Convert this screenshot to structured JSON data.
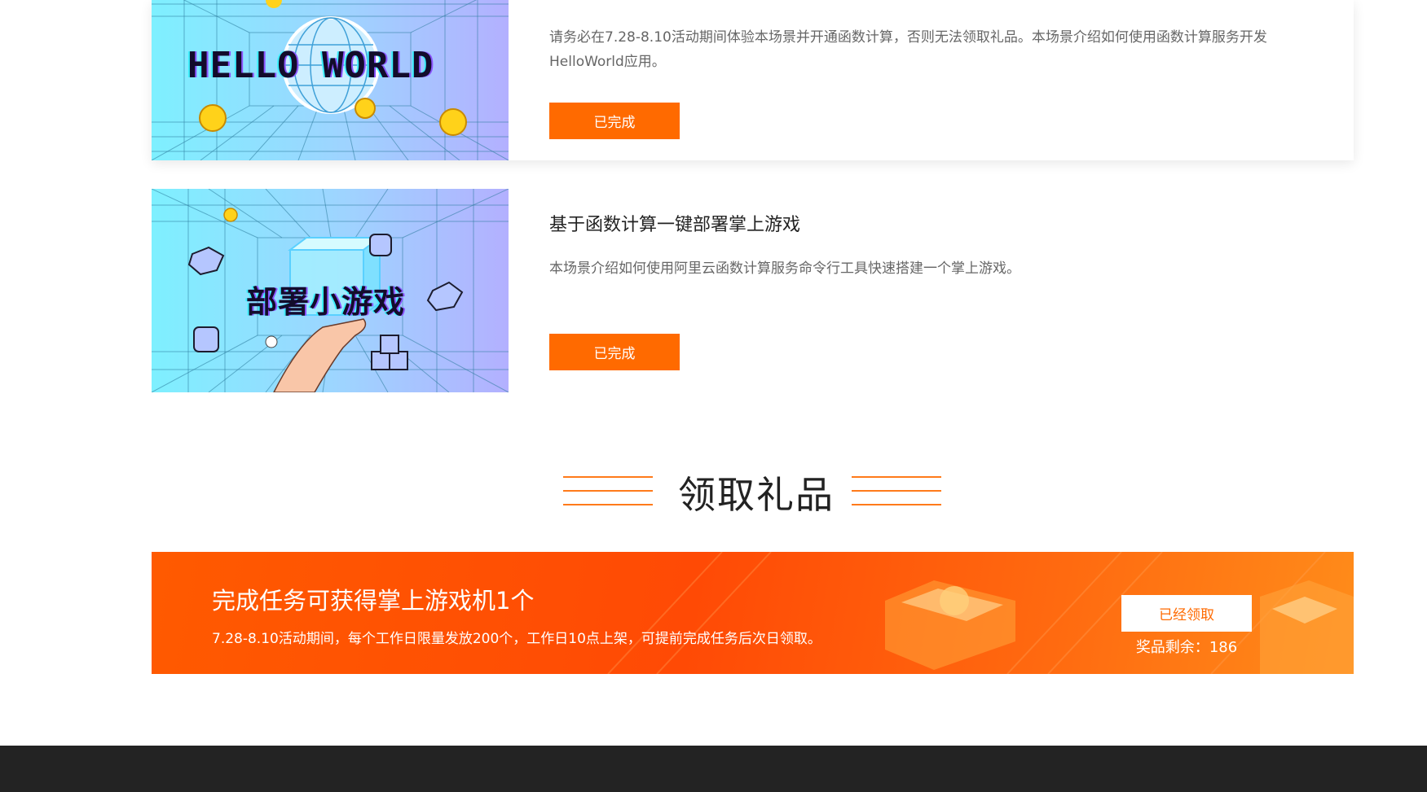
{
  "tasks": [
    {
      "thumb_text": "HELLO WORLD",
      "title": "",
      "desc": "请务必在7.28-8.10活动期间体验本场景并开通函数计算，否则无法领取礼品。本场景介绍如何使用函数计算服务开发HelloWorld应用。",
      "button": "已完成"
    },
    {
      "thumb_text": "部署小游戏",
      "title": "基于函数计算一键部署掌上游戏",
      "desc": "本场景介绍如何使用阿里云函数计算服务命令行工具快速搭建一个掌上游戏。",
      "button": "已完成"
    }
  ],
  "section": {
    "title": "领取礼品"
  },
  "gift": {
    "title": "完成任务可获得掌上游戏机1个",
    "desc": "7.28-8.10活动期间，每个工作日限量发放200个，工作日10点上架，可提前完成任务后次日领取。",
    "button": "已经领取",
    "remain_label": "奖品剩余：",
    "remain_value": "186"
  },
  "colors": {
    "accent": "#ff6a00",
    "footer": "#232323"
  }
}
